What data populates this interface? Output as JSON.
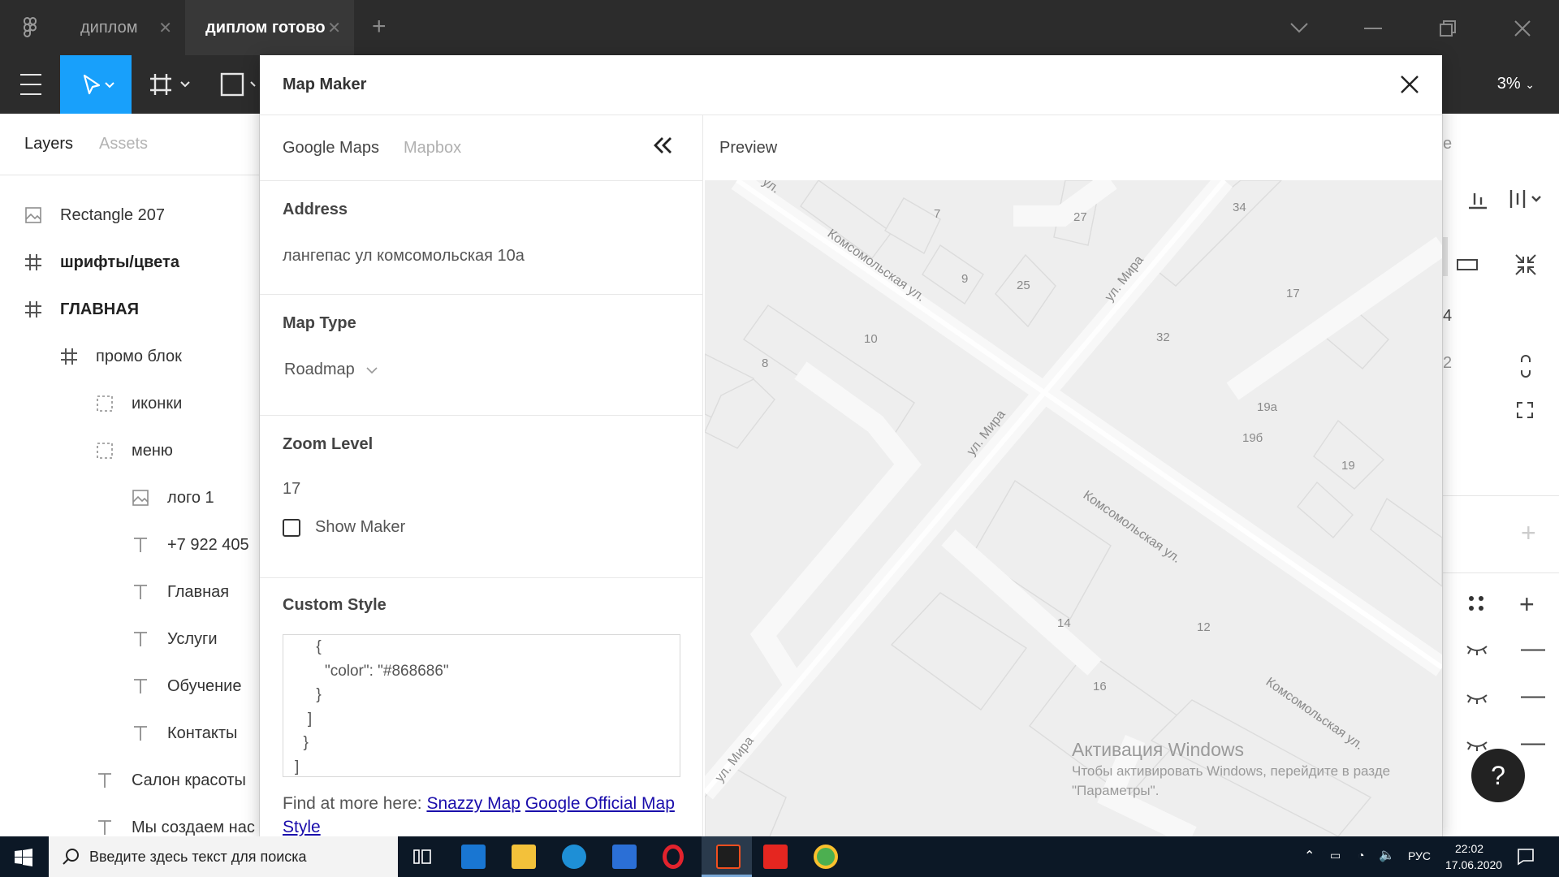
{
  "window": {
    "tabs": [
      {
        "label": "диплом"
      },
      {
        "label": "диплом готово"
      }
    ],
    "zoom": "3%"
  },
  "layers_panel": {
    "tabs": [
      "Layers",
      "Assets"
    ],
    "items": [
      {
        "label": "Rectangle 207",
        "icon": "image-icon"
      },
      {
        "label": "шрифты/цвета",
        "icon": "frame-icon"
      },
      {
        "label": "ГЛАВНАЯ",
        "icon": "frame-icon"
      },
      {
        "label": "промо блок",
        "icon": "frame-icon"
      },
      {
        "label": "иконки",
        "icon": "group-icon"
      },
      {
        "label": "меню",
        "icon": "group-icon"
      },
      {
        "label": "лого 1",
        "icon": "image-icon"
      },
      {
        "label": "+7 922 405",
        "icon": "text-icon"
      },
      {
        "label": "Главная",
        "icon": "text-icon"
      },
      {
        "label": "Услуги",
        "icon": "text-icon"
      },
      {
        "label": "Обучение",
        "icon": "text-icon"
      },
      {
        "label": "Контакты",
        "icon": "text-icon"
      },
      {
        "label": "Салон красоты",
        "icon": "text-icon"
      },
      {
        "label": "Мы создаем нас",
        "icon": "text-icon"
      }
    ]
  },
  "right_panel": {
    "partial_texts": [
      "e",
      "4",
      "2"
    ]
  },
  "dialog": {
    "title": "Map Maker",
    "providers": [
      "Google Maps",
      "Mapbox"
    ],
    "preview_label": "Preview",
    "address_label": "Address",
    "address_value": "лангепас ул комсомольская 10а",
    "map_type_label": "Map Type",
    "map_type_value": "Roadmap",
    "zoom_label": "Zoom Level",
    "zoom_value": "17",
    "show_marker_label": "Show Maker",
    "custom_style_label": "Custom Style",
    "custom_style_code": "     {\n       \"color\": \"#868686\"\n     }\n   ]\n  }\n]",
    "find_more_text": "Find at more here:",
    "link1": "Snazzy Map",
    "link2": "Google Official Map Style"
  },
  "map": {
    "streets": [
      "Комсомольская ул.",
      "ул. Мира",
      "ул. Мира",
      "Комсомольская ул.",
      "Комсомольская ул.",
      "ул. Мира",
      "ул."
    ],
    "house_numbers": [
      "7",
      "27",
      "34",
      "9",
      "25",
      "17",
      "10",
      "32",
      "8",
      "19а",
      "19б",
      "19",
      "14",
      "12",
      "16"
    ],
    "watermark_title": "Активация Windows",
    "watermark_line1": "Чтобы активировать Windows, перейдите в разде",
    "watermark_line2": "\"Параметры\"."
  },
  "taskbar": {
    "search_placeholder": "Введите здесь текст для поиска",
    "language": "РУС",
    "time": "22:02",
    "date": "17.06.2020"
  }
}
